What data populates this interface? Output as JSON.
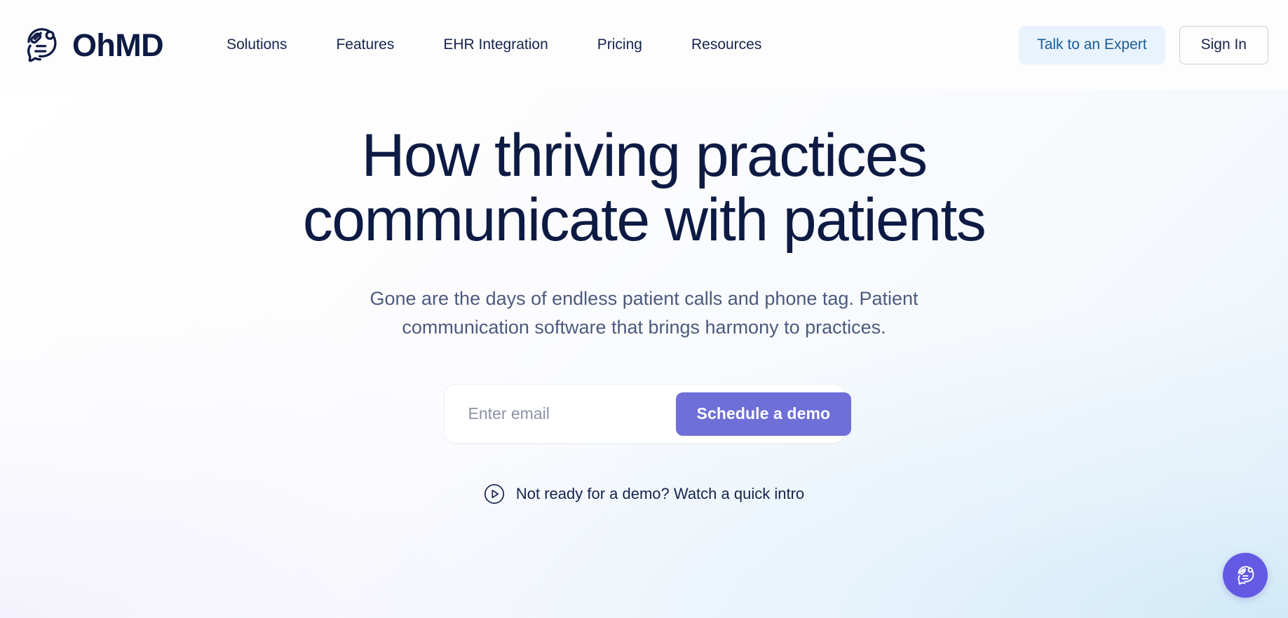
{
  "brand": {
    "name": "OhMD",
    "logo_icon": "ohmd-speech-bubble-icon"
  },
  "nav": {
    "items": [
      {
        "label": "Solutions"
      },
      {
        "label": "Features"
      },
      {
        "label": "EHR Integration"
      },
      {
        "label": "Pricing"
      },
      {
        "label": "Resources"
      }
    ]
  },
  "header_actions": {
    "expert_label": "Talk to an Expert",
    "signin_label": "Sign In",
    "expert_bg": "#e9f3fd",
    "expert_text_color": "#1a5a94"
  },
  "hero": {
    "title": "How thriving practices communicate with patients",
    "subtitle": "Gone are the days of endless patient calls and phone tag. Patient communication software that brings harmony to practices.",
    "title_color": "#0d1b44",
    "subtitle_color": "#4c5a7d"
  },
  "signup": {
    "email_placeholder": "Enter email",
    "email_value": "",
    "submit_label": "Schedule a demo",
    "submit_color": "#6f6fd8"
  },
  "intro": {
    "icon": "play-circle-icon",
    "label": "Not ready for a demo? Watch a quick intro"
  },
  "chat_widget": {
    "icon": "ohmd-speech-bubble-icon",
    "background": "#6359e3"
  }
}
